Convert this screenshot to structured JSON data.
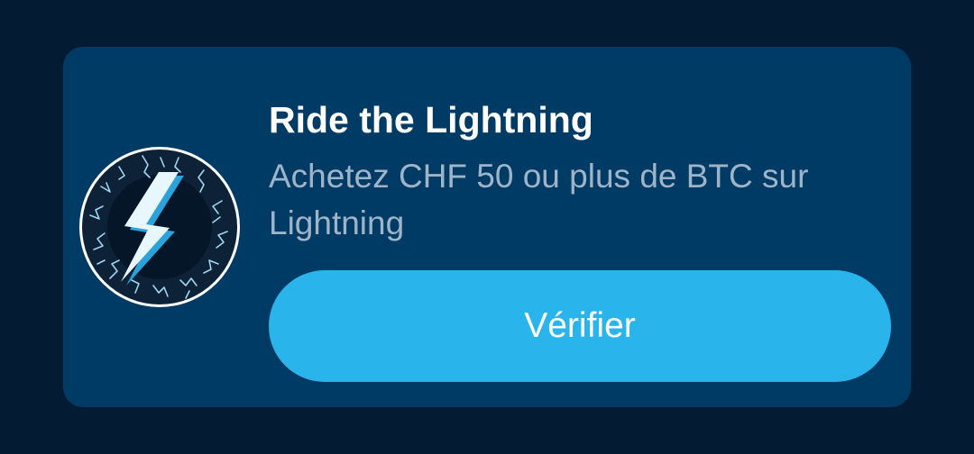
{
  "card": {
    "icon": "lightning-bolt-icon",
    "title": "Ride the Lightning",
    "description": "Achetez CHF 50 ou plus de BTC sur Lightning",
    "button_label": "Vérifier"
  },
  "colors": {
    "page_background": "#041c33",
    "card_background": "#003b66",
    "button_background": "#29b5ec",
    "title_text": "#ffffff",
    "description_text": "#9fb4c8"
  }
}
